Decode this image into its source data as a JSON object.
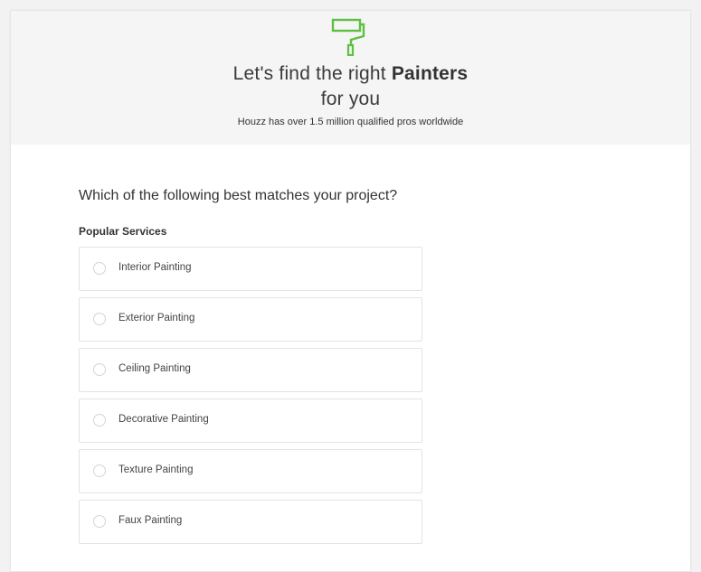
{
  "header": {
    "icon": "paint-roller-icon",
    "accent_color": "#5cc13f",
    "title_prefix": "Let's find the right ",
    "title_highlight": "Painters",
    "title_suffix": "for you",
    "subtitle": "Houzz has over 1.5 million qualified pros worldwide"
  },
  "main": {
    "question": "Which of the following best matches your project?",
    "section_label": "Popular Services",
    "options": [
      {
        "label": "Interior Painting",
        "selected": false
      },
      {
        "label": "Exterior Painting",
        "selected": false
      },
      {
        "label": "Ceiling Painting",
        "selected": false
      },
      {
        "label": "Decorative Painting",
        "selected": false
      },
      {
        "label": "Texture Painting",
        "selected": false
      },
      {
        "label": "Faux Painting",
        "selected": false
      }
    ]
  }
}
